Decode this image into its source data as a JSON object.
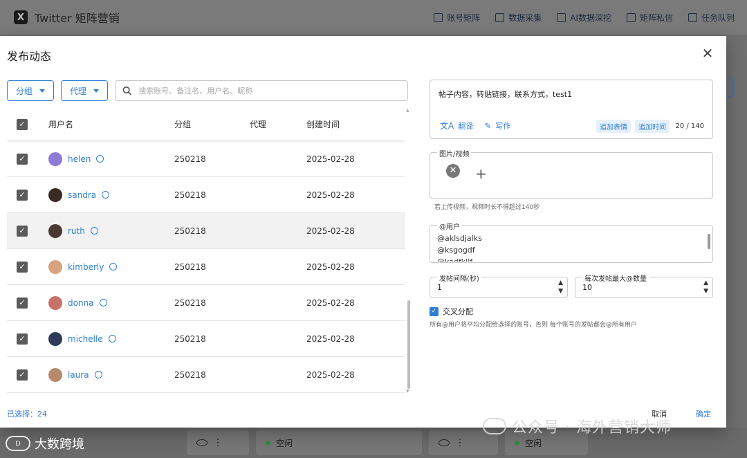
{
  "app": {
    "title": "Twitter 矩阵营销",
    "nav": [
      {
        "label": "账号矩阵",
        "icon": "account-matrix-icon"
      },
      {
        "label": "数据采集",
        "icon": "grid-icon"
      },
      {
        "label": "AI数据深挖",
        "icon": "hourglass-icon"
      },
      {
        "label": "矩阵私信",
        "icon": "message-icon"
      },
      {
        "label": "任务队列",
        "icon": "refresh-icon"
      }
    ],
    "bottom_cards": [
      "空闲",
      "空闲"
    ]
  },
  "dialog": {
    "title": "发布动态",
    "group_label": "分组",
    "proxy_label": "代理",
    "search_placeholder": "搜索账号、备注名、用户名、昵称",
    "columns": [
      "用户名",
      "分组",
      "代理",
      "创建时间"
    ],
    "rows": [
      {
        "username": "helen",
        "group": "250218",
        "proxy": "",
        "created": "2025-02-28",
        "avatar_color": "#8e7bd6"
      },
      {
        "username": "sandra",
        "group": "250218",
        "proxy": "",
        "created": "2025-02-28",
        "avatar_color": "#3a2b25"
      },
      {
        "username": "ruth",
        "group": "250218",
        "proxy": "",
        "created": "2025-02-28",
        "avatar_color": "#4a3a30"
      },
      {
        "username": "kimberly",
        "group": "250218",
        "proxy": "",
        "created": "2025-02-28",
        "avatar_color": "#d9a27f"
      },
      {
        "username": "donna",
        "group": "250218",
        "proxy": "",
        "created": "2025-02-28",
        "avatar_color": "#c8736a"
      },
      {
        "username": "michelle",
        "group": "250218",
        "proxy": "",
        "created": "2025-02-28",
        "avatar_color": "#2d3a5a"
      },
      {
        "username": "laura",
        "group": "250218",
        "proxy": "",
        "created": "2025-02-28",
        "avatar_color": "#b78a6e"
      }
    ],
    "selected_text": "已选择：24",
    "post_content": "帖子内容，转贴链接，联系方式，test1",
    "translate_label": "翻译",
    "write_label": "写作",
    "add_emoji_label": "追加表情",
    "add_time_label": "追加时间",
    "char_counter": "20 / 140",
    "media_legend": "图片/视频",
    "media_hint": "若上传视频，视频时长不得超过140秒",
    "mentions_legend": "@用户",
    "mentions": [
      "@aklsdjalks",
      "@ksgogdf",
      "@kadfkllf"
    ],
    "interval_legend": "发帖间隔(秒)",
    "interval_value": "1",
    "max_mentions_legend": "每次发帖最大@数量",
    "max_mentions_value": "10",
    "cross_label": "交叉分配",
    "cross_hint": "所有@用户将平均分配给选择的账号，否则 每个账号的发帖都会@所有用户",
    "cancel_label": "取消",
    "confirm_label": "确定"
  },
  "watermark": {
    "right": "公众号 · 海外营销大师",
    "left": "大数跨境"
  },
  "colors": {
    "accent": "#2f7fd6",
    "checkbox": "#5b5b5b"
  }
}
